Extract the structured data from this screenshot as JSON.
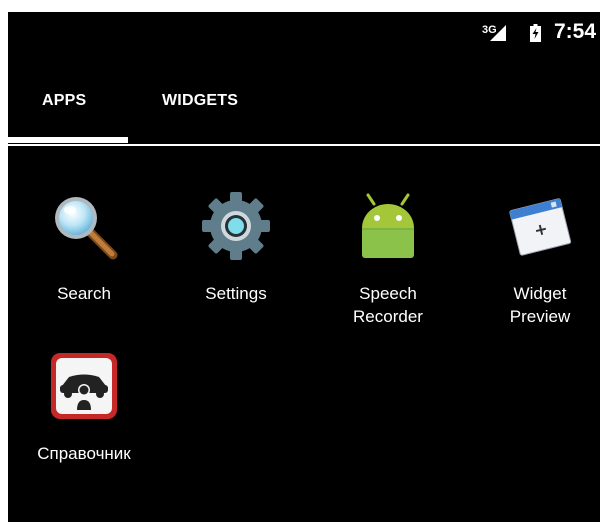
{
  "status_bar": {
    "network": "3G",
    "time": "7:54"
  },
  "tabs": [
    {
      "label": "APPS",
      "selected": true
    },
    {
      "label": "WIDGETS",
      "selected": false
    }
  ],
  "apps": [
    {
      "label": "Search",
      "icon": "search-icon"
    },
    {
      "label": "Settings",
      "icon": "settings-gear-icon"
    },
    {
      "label_line1": "Speech",
      "label_line2": "Recorder",
      "icon": "android-icon"
    },
    {
      "label_line1": "Widget",
      "label_line2": "Preview",
      "icon": "widget-preview-icon"
    },
    {
      "label": "Справочник",
      "icon": "car-person-icon"
    }
  ],
  "colors": {
    "background": "#000000",
    "text": "#ffffff",
    "android_green": "#a4c639",
    "settings_gray": "#607d8b",
    "settings_teal": "#80deea",
    "badge_red": "#d32f2f"
  }
}
